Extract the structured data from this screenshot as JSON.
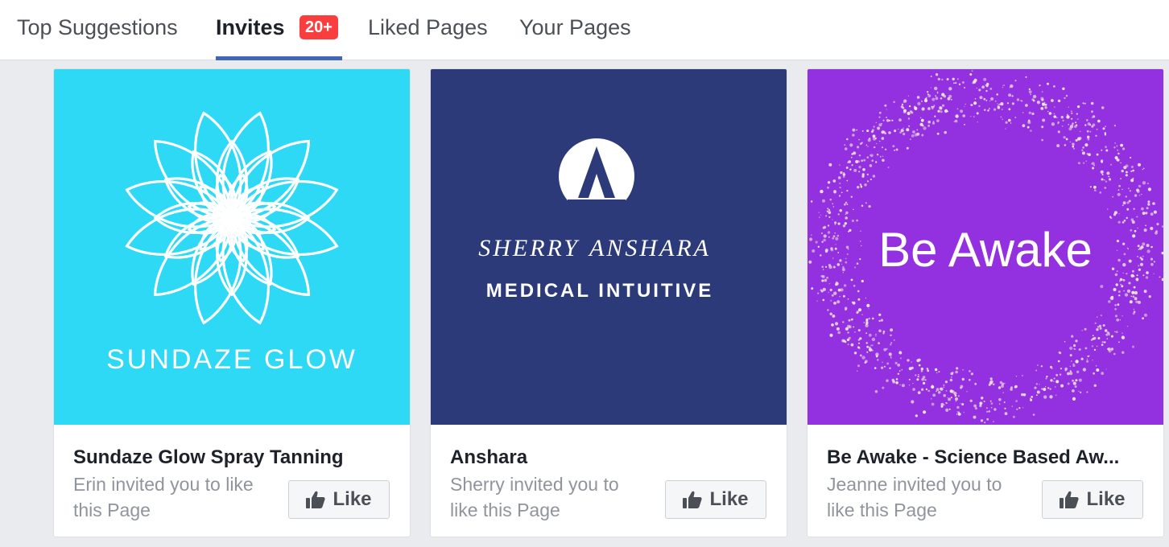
{
  "tabs": [
    {
      "label": "Top Suggestions"
    },
    {
      "label": "Invites",
      "badge": "20+"
    },
    {
      "label": "Liked Pages"
    },
    {
      "label": "Your Pages"
    }
  ],
  "like_label": "Like",
  "like_icon": "thumbs-up-icon",
  "colors": {
    "active_tab_underline": "#4267b2",
    "badge": "#fa3e3e"
  },
  "cards": [
    {
      "name": "Sundaze Glow Spray Tanning",
      "invite": "Erin invited you to like this Page",
      "cover": {
        "bg": "#2ed9f5",
        "logo_text": "SUNDAZE GLOW",
        "icon": "lotus-mandala-icon"
      }
    },
    {
      "name": "Anshara",
      "invite": "Sherry invited you to like this Page",
      "cover": {
        "bg": "#2d3a7a",
        "logo_left": "SHERRY",
        "logo_right": "ANSHARA",
        "logo_sub": "MEDICAL INTUITIVE",
        "icon": "letter-a-circle-icon"
      }
    },
    {
      "name": "Be Awake - Science Based Aw...",
      "invite": "Jeanne invited you to like this Page",
      "cover": {
        "bg": "#9330e0",
        "logo_text": "Be Awake",
        "icon": "speckled-ring-icon"
      }
    }
  ]
}
